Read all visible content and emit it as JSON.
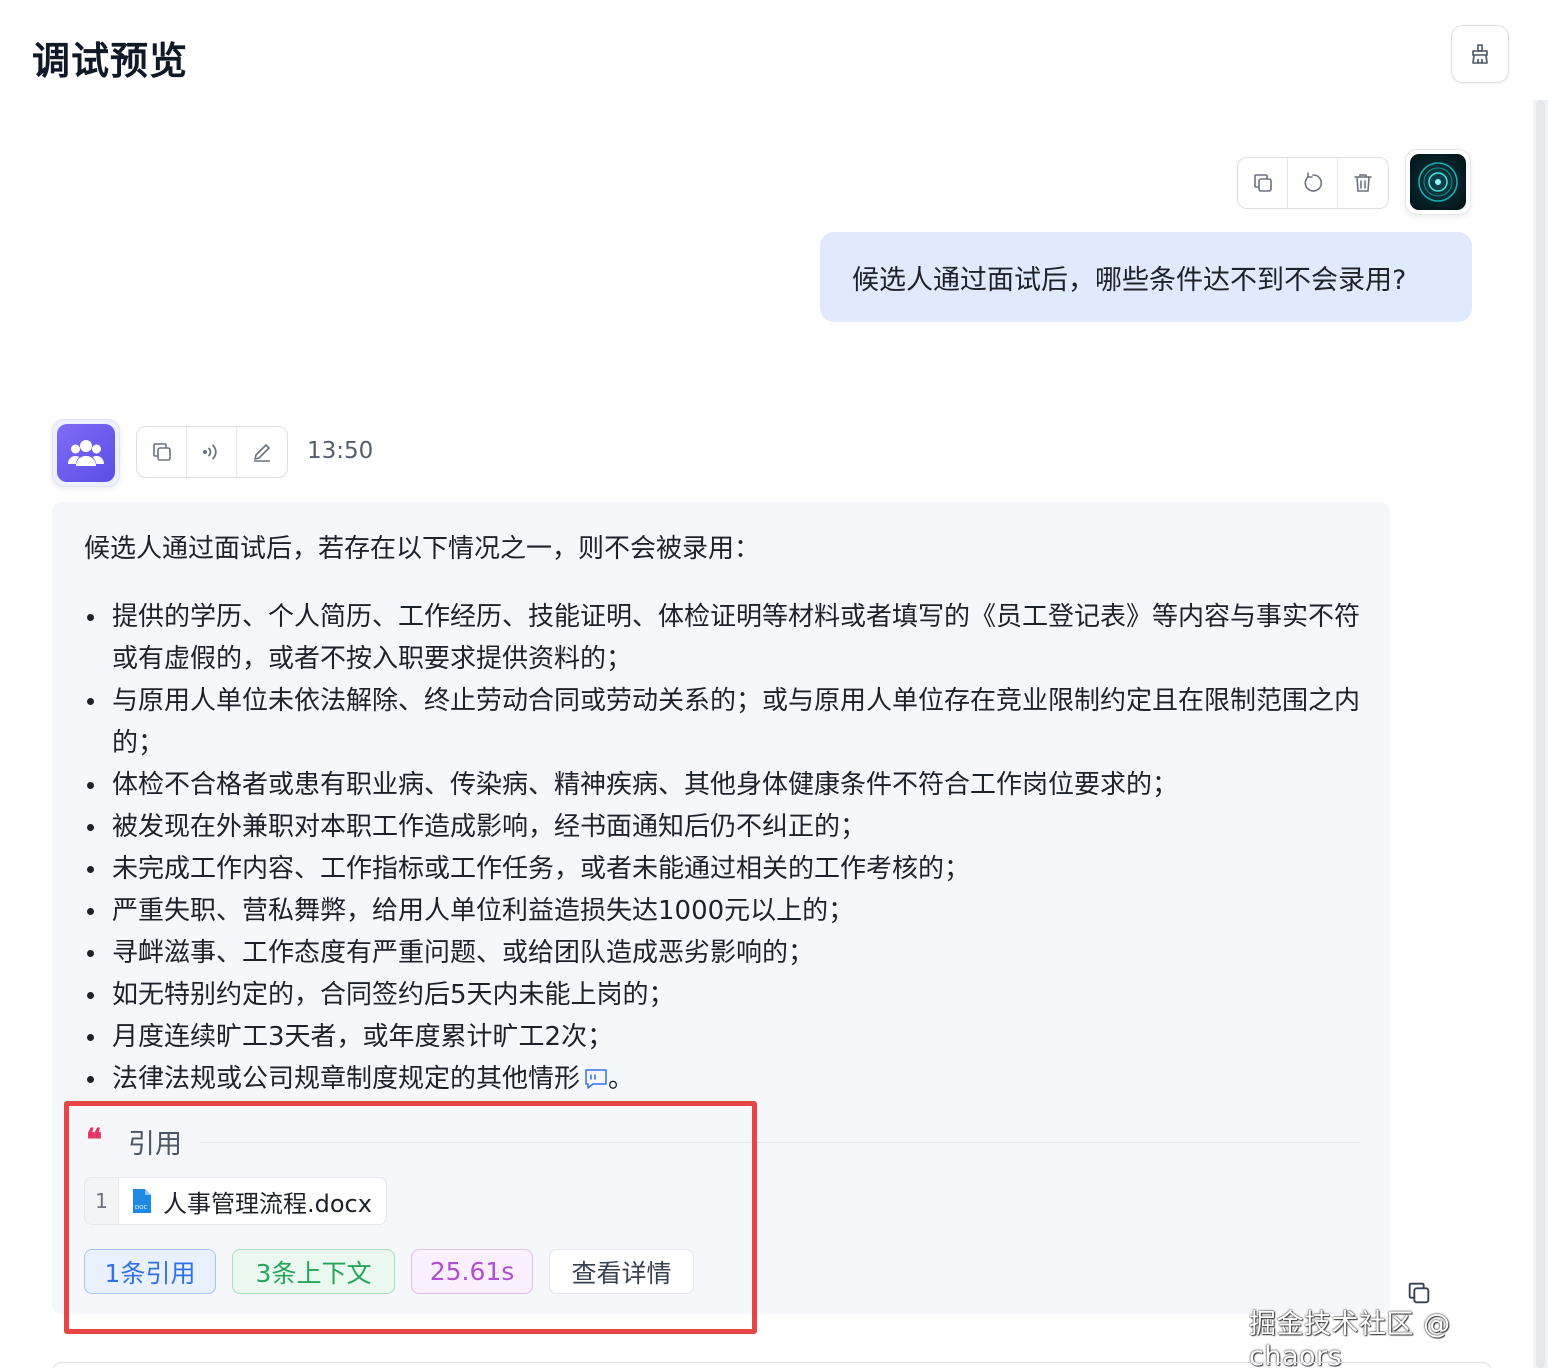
{
  "header": {
    "title": "调试预览"
  },
  "user_message": {
    "text": "候选人通过面试后，哪些条件达不到不会录用?"
  },
  "bot_message": {
    "time": "13:50",
    "intro": "候选人通过面试后，若存在以下情况之一，则不会被录用：",
    "items": [
      "提供的学历、个人简历、工作经历、技能证明、体检证明等材料或者填写的《员工登记表》等内容与事实不符或有虚假的，或者不按入职要求提供资料的；",
      "与原用人单位未依法解除、终止劳动合同或劳动关系的；或与原用人单位存在竞业限制约定且在限制范围之内的；",
      "体检不合格者或患有职业病、传染病、精神疾病、其他身体健康条件不符合工作岗位要求的；",
      "被发现在外兼职对本职工作造成影响，经书面通知后仍不纠正的；",
      "未完成工作内容、工作指标或工作任务，或者未能通过相关的工作考核的；",
      "严重失职、营私舞弊，给用人单位利益造损失达1000元以上的；",
      "寻衅滋事、工作态度有严重问题、或给团队造成恶劣影响的；",
      "如无特别约定的，合同签约后5天内未能上岗的；",
      "月度连续旷工3天者，或年度累计旷工2次；",
      "法律法规或公司规章制度规定的其他情形"
    ],
    "last_item_suffix": "。"
  },
  "quote": {
    "label": "引用",
    "file_index": "1",
    "file_name": "人事管理流程.docx",
    "file_icon_text": "DOC"
  },
  "tags": {
    "refs": "1条引用",
    "context": "3条上下文",
    "duration": "25.61s",
    "detail": "查看详情"
  },
  "watermark": "掘金技术社区 @ chaors",
  "colors": {
    "user_bubble": "#e1eafc",
    "bot_bubble": "#f5f7fa",
    "highlight": "#e54545",
    "quote_accent": "#e5366b"
  }
}
